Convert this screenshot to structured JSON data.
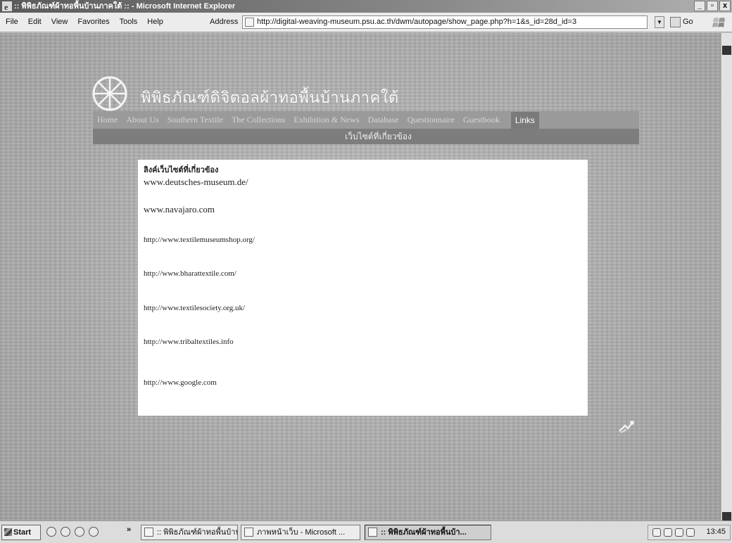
{
  "window": {
    "title": ":: พิพิธภัณฑ์ผ้าทอพื้นบ้านภาคใต้ :: - Microsoft Internet Explorer",
    "minimize": "_",
    "maximize": "▫",
    "close": "x"
  },
  "menu": [
    "File",
    "Edit",
    "View",
    "Favorites",
    "Tools",
    "Help"
  ],
  "address": {
    "label": "Address",
    "url": "http://digital-weaving-museum.psu.ac.th/dwm/autopage/show_page.php?h=1&s_id=28d_id=3",
    "go": "Go"
  },
  "site": {
    "title": "พิพิธภัณฑ์ดิจิตอลผ้าทอพื้นบ้านภาคใต้",
    "nav": [
      "Home",
      "About Us",
      "Southern Textile",
      "The Collections",
      "Exhibition & News",
      "Database",
      "Questionnaire",
      "Guestbook",
      "Links"
    ],
    "active_nav": "Links",
    "subbar": "เว็บไซต์ที่เกี่ยวข้อง"
  },
  "content": {
    "heading": "ลิงค์เว็บไซต์ที่เกี่ยวข้อง",
    "links": [
      "www.deutsches-museum.de/",
      "www.navajaro.com",
      "http://www.textilemuseumshop.org/",
      "http://www.bharattextile.com/",
      "http://www.textilesociety.org.uk/",
      "http://www.tribaltextiles.info",
      "http://www.google.com"
    ]
  },
  "footer": {
    "credit": ""
  },
  "taskbar": {
    "start": "Start",
    "chevron": "»",
    "tasks": [
      ":: พิพิธภัณฑ์ผ้าทอพื้นบ้าน...",
      "ภาพหน้าเว็บ - Microsoft ...",
      ":: พิพิธภัณฑ์ผ้าทอพื้นบ้า..."
    ],
    "clock": "13:45"
  },
  "colors": {
    "nav_bar": "#9a9a9a",
    "sub_bar": "#7d7d7d",
    "active_tab": "#7a7a7a",
    "panel": "#ffffff"
  }
}
